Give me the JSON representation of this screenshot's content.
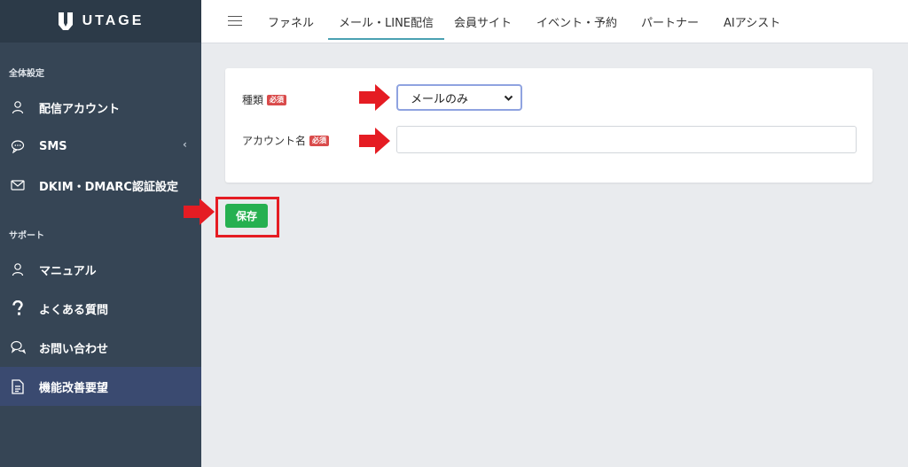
{
  "app": {
    "logo_text": "UTAGE"
  },
  "sidebar": {
    "sections": [
      {
        "title": "全体設定"
      },
      {
        "title": "サポート"
      }
    ],
    "items": [
      {
        "label": "配信アカウント",
        "icon": "user-icon"
      },
      {
        "label": "SMS",
        "icon": "chat-bubble-icon"
      },
      {
        "label": "DKIM・DMARC認証設定",
        "icon": "mail-icon"
      },
      {
        "label": "マニュアル",
        "icon": "user-icon"
      },
      {
        "label": "よくある質問",
        "icon": "question-icon"
      },
      {
        "label": "お問い合わせ",
        "icon": "chat-bubbles-icon"
      },
      {
        "label": "機能改善要望",
        "icon": "document-icon",
        "active": true
      }
    ]
  },
  "topnav": {
    "tabs": [
      {
        "label": "ファネル"
      },
      {
        "label": "メール・LINE配信",
        "active": true
      },
      {
        "label": "会員サイト"
      },
      {
        "label": "イベント・予約"
      },
      {
        "label": "パートナー"
      },
      {
        "label": "AIアシスト"
      }
    ]
  },
  "form": {
    "type_label": "種類",
    "required_badge": "必須",
    "type_value": "メールのみ",
    "account_name_label": "アカウント名",
    "account_name_value": "",
    "save_label": "保存"
  },
  "colors": {
    "sidebar_bg": "#364555",
    "sidebar_active": "#3a4a70",
    "accent_tab": "#4aa1b2",
    "save_button": "#26b050",
    "annotation_red": "#e51c23"
  }
}
